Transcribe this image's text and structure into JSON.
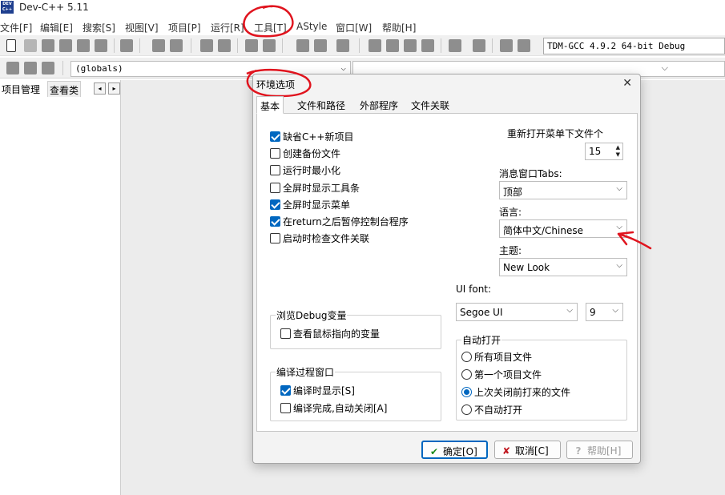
{
  "app": {
    "title": "Dev-C++ 5.11",
    "logo_text": "DEV C++"
  },
  "menu": [
    {
      "label": "文件[F]"
    },
    {
      "label": "编辑[E]"
    },
    {
      "label": "搜索[S]"
    },
    {
      "label": "视图[V]"
    },
    {
      "label": "项目[P]"
    },
    {
      "label": "运行[R]"
    },
    {
      "label": "工具[T]"
    },
    {
      "label": "AStyle"
    },
    {
      "label": "窗口[W]"
    },
    {
      "label": "帮助[H]"
    }
  ],
  "toolbar": {
    "compiler_profile": "TDM-GCC 4.9.2 64-bit Debug",
    "class_scope": "(globals)"
  },
  "left_panel": {
    "tab_project": "项目管理",
    "tab_classes": "查看类",
    "prev_arrow": "◂",
    "next_arrow": "▸"
  },
  "dialog": {
    "title": "环境选项",
    "close_glyph": "✕",
    "tabs": [
      {
        "label": "基本",
        "active": true
      },
      {
        "label": "文件和路径",
        "active": false
      },
      {
        "label": "外部程序",
        "active": false
      },
      {
        "label": "文件关联",
        "active": false
      }
    ],
    "options": [
      {
        "label": "缺省C++新项目",
        "checked": true
      },
      {
        "label": "创建备份文件",
        "checked": false
      },
      {
        "label": "运行时最小化",
        "checked": false
      },
      {
        "label": "全屏时显示工具条",
        "checked": false
      },
      {
        "label": "全屏时显示菜单",
        "checked": true
      },
      {
        "label": "在return之后暂停控制台程序",
        "checked": true
      },
      {
        "label": "启动时检查文件关联",
        "checked": false
      }
    ],
    "reopen": {
      "label": "重新打开菜单下文件个",
      "value": "15"
    },
    "msg_tabs": {
      "label": "消息窗口Tabs:",
      "value": "顶部"
    },
    "language": {
      "label": "语言:",
      "value": "简体中文/Chinese"
    },
    "theme": {
      "label": "主题:",
      "value": "New Look"
    },
    "ui_font": {
      "label": "UI font:",
      "family": "Segoe UI",
      "size": "9"
    },
    "debug_group": {
      "title": "浏览Debug变量",
      "option": {
        "label": "查看鼠标指向的变量",
        "checked": false
      }
    },
    "compile_group": {
      "title": "编译过程窗口",
      "options": [
        {
          "label": "编译时显示[S]",
          "checked": true
        },
        {
          "label": "编译完成,自动关闭[A]",
          "checked": false
        }
      ]
    },
    "autoopen_group": {
      "title": "自动打开",
      "options": [
        {
          "label": "所有项目文件",
          "selected": false
        },
        {
          "label": "第一个项目文件",
          "selected": false
        },
        {
          "label": "上次关闭前打来的文件",
          "selected": true
        },
        {
          "label": "不自动打开",
          "selected": false
        }
      ]
    },
    "buttons": {
      "ok": "确定[O]",
      "cancel": "取消[C]",
      "help": "帮助[H]"
    }
  },
  "colors": {
    "accent": "#0067c0",
    "annotation": "#e0141e"
  }
}
